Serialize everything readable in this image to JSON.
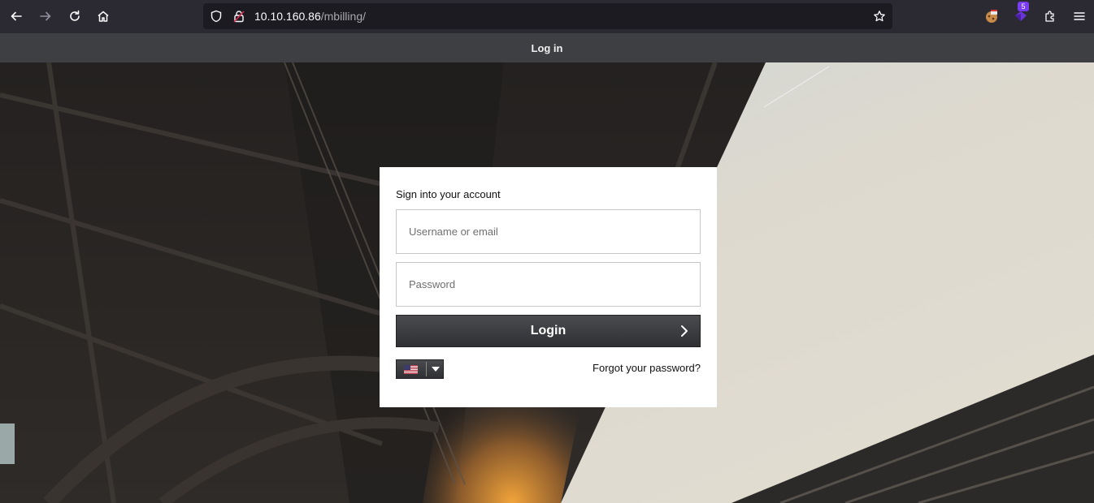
{
  "browser": {
    "url_host": "10.10.160.86",
    "url_path": "/mbilling/",
    "extension_badge": "5"
  },
  "header": {
    "title": "Log in"
  },
  "login": {
    "heading": "Sign into your account",
    "username_placeholder": "Username or email",
    "password_placeholder": "Password",
    "submit_label": "Login",
    "forgot_label": "Forgot your password?",
    "language_flag": "us-flag-icon"
  },
  "colors": {
    "chrome": "#2b2a33",
    "header": "#3e3f42",
    "button": "#3a3b3e",
    "panel": "#ffffff"
  }
}
